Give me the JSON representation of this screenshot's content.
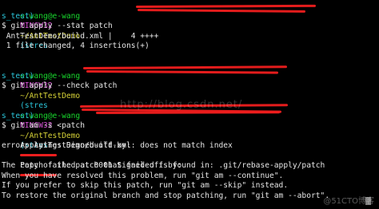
{
  "terminal": {
    "lines": {
      "l1_prompt_user": "e.wang@e-wang",
      "l1_prompt_shell": "MINGW32",
      "l1_prompt_path": "~/AntTestDemo",
      "l1_prompt_branch": "(stres",
      "l2_prompt_branch_cont": "s_test)",
      "l3_cmd": "$ git apply --stat patch",
      "l4_out": " AntTestDemo/build.xml |    4 ++++",
      "l5_out": " 1 file changed, 4 insertions(+)",
      "l7_prompt_user": "e.wang@e-wang",
      "l7_prompt_shell": "MINGW32",
      "l7_prompt_path": "~/AntTestDemo",
      "l7_prompt_branch": "(stres",
      "l8_prompt_branch_cont": "s_test)",
      "l9_cmd": "$ git apply --check patch",
      "l11_prompt_user": "e.wang@e-wang",
      "l11_prompt_shell": "MINGW32",
      "l11_prompt_path": "~/AntTestDemo",
      "l11_prompt_branch": "(stres",
      "l12_prompt_branch_cont": "s_test)",
      "l13_cmd": "$ git am -s <patch",
      "l14_out": "Applying: Signed-off-by:",
      "l15_out": "error: AntTestDemo/build.xml: does not match index",
      "l16_out": "Patch failed at 0001 Signed-off-by:",
      "l17_out": "The copy of the patch that failed is found in: .git/rebase-apply/patch",
      "l18_out": "When you have resolved this problem, run \"git am --continue\".",
      "l19_out": "If you prefer to skip this patch, run \"git am --skip\" instead.",
      "l20_out": "To restore the original branch and stop patching, run \"git am --abort\"."
    }
  },
  "overlay": {
    "watermark": "http://blog.csdn.net/",
    "logo": "@51CTO博客"
  },
  "colors": {
    "user": "#18d62d",
    "shell": "#d34fd3",
    "path": "#d6d237",
    "branch": "#2bc7dc",
    "text": "#e6e6e6",
    "scribble": "#f01e1e",
    "background": "#000000"
  }
}
